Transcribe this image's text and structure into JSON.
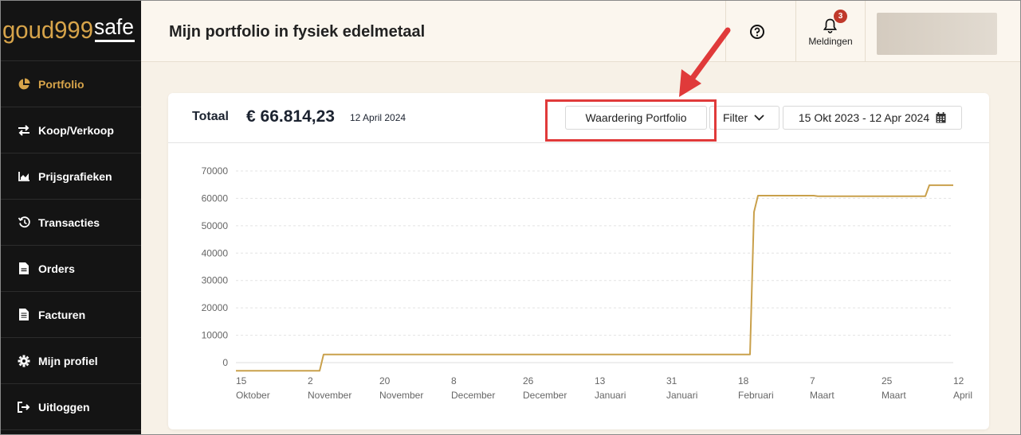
{
  "sidebar": {
    "logo_text": "goud999safe",
    "items": [
      {
        "label": "Portfolio",
        "icon": "pie-chart-icon",
        "active": true
      },
      {
        "label": "Koop/Verkoop",
        "icon": "exchange-arrows-icon",
        "active": false
      },
      {
        "label": "Prijsgrafieken",
        "icon": "area-chart-icon",
        "active": false
      },
      {
        "label": "Transacties",
        "icon": "history-icon",
        "active": false
      },
      {
        "label": "Orders",
        "icon": "document-icon",
        "active": false
      },
      {
        "label": "Facturen",
        "icon": "invoice-icon",
        "active": false
      },
      {
        "label": "Mijn profiel",
        "icon": "gear-icon",
        "active": false
      },
      {
        "label": "Uitloggen",
        "icon": "logout-icon",
        "active": false
      }
    ]
  },
  "header": {
    "title": "Mijn portfolio in fysiek edelmetaal",
    "help_icon": "question-circle-icon",
    "notifications": {
      "label": "Meldingen",
      "count": "3",
      "icon": "bell-icon"
    }
  },
  "card": {
    "total_label": "Totaal",
    "total_value": "€ 66.814,23",
    "total_date": "12 April 2024",
    "valuation_button": "Waardering Portfolio",
    "filter_button": "Filter",
    "date_range": "15 Okt 2023 - 12 Apr 2024",
    "calendar_icon": "calendar-icon"
  },
  "colors": {
    "accent": "#d7a44a",
    "line": "#c9a04b",
    "sidebar_bg": "#141414",
    "highlight": "#e03a3a"
  },
  "chart_data": {
    "type": "line",
    "title": "",
    "xlabel": "",
    "ylabel": "",
    "ylim": [
      0,
      70000
    ],
    "yticks": [
      0,
      10000,
      20000,
      30000,
      40000,
      50000,
      60000,
      70000
    ],
    "xticks": [
      {
        "date": "2023-10-15",
        "day": "15",
        "month": "Oktober"
      },
      {
        "date": "2023-11-02",
        "day": "2",
        "month": "November"
      },
      {
        "date": "2023-11-20",
        "day": "20",
        "month": "November"
      },
      {
        "date": "2023-12-08",
        "day": "8",
        "month": "December"
      },
      {
        "date": "2023-12-26",
        "day": "26",
        "month": "December"
      },
      {
        "date": "2024-01-13",
        "day": "13",
        "month": "Januari"
      },
      {
        "date": "2024-01-31",
        "day": "31",
        "month": "Januari"
      },
      {
        "date": "2024-02-18",
        "day": "18",
        "month": "Februari"
      },
      {
        "date": "2024-03-07",
        "day": "7",
        "month": "Maart"
      },
      {
        "date": "2024-03-25",
        "day": "25",
        "month": "Maart"
      },
      {
        "date": "2024-04-12",
        "day": "12",
        "month": "April"
      }
    ],
    "grid": true,
    "series": [
      {
        "points": [
          {
            "x": "2023-10-15",
            "y": -3000
          },
          {
            "x": "2023-11-05",
            "y": -3000
          },
          {
            "x": "2023-11-06",
            "y": 3000
          },
          {
            "x": "2024-02-21",
            "y": 3000
          },
          {
            "x": "2024-02-22",
            "y": 55000
          },
          {
            "x": "2024-02-23",
            "y": 61000
          },
          {
            "x": "2024-03-08",
            "y": 61000
          },
          {
            "x": "2024-03-09",
            "y": 60800
          },
          {
            "x": "2024-04-05",
            "y": 60800
          },
          {
            "x": "2024-04-06",
            "y": 64800
          },
          {
            "x": "2024-04-12",
            "y": 64800
          }
        ]
      }
    ]
  }
}
